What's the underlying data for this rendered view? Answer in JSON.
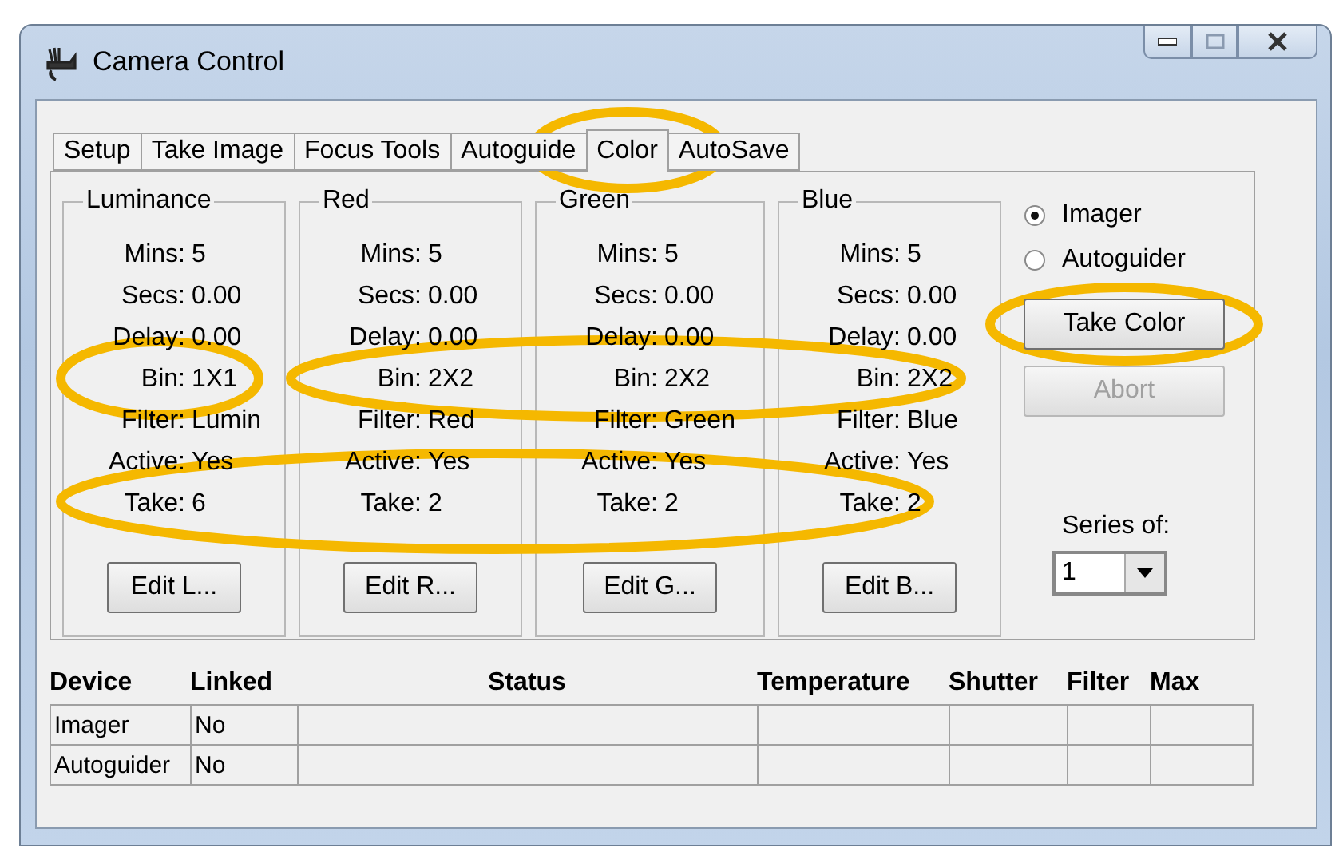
{
  "window": {
    "title": "Camera Control"
  },
  "tabs": [
    {
      "label": "Setup",
      "selected": false
    },
    {
      "label": "Take Image",
      "selected": false
    },
    {
      "label": "Focus Tools",
      "selected": false
    },
    {
      "label": "Autoguide",
      "selected": false
    },
    {
      "label": "Color",
      "selected": true
    },
    {
      "label": "AutoSave",
      "selected": false
    }
  ],
  "groups": [
    {
      "title": "Luminance",
      "fields": [
        {
          "label": "Mins:",
          "value": "5"
        },
        {
          "label": "Secs:",
          "value": "0.00"
        },
        {
          "label": "Delay:",
          "value": "0.00"
        },
        {
          "label": "Bin:",
          "value": "1X1"
        },
        {
          "label": "Filter:",
          "value": "Lumin"
        },
        {
          "label": "Active:",
          "value": "Yes"
        },
        {
          "label": "Take:",
          "value": "6"
        }
      ],
      "button": "Edit L..."
    },
    {
      "title": "Red",
      "fields": [
        {
          "label": "Mins:",
          "value": "5"
        },
        {
          "label": "Secs:",
          "value": "0.00"
        },
        {
          "label": "Delay:",
          "value": "0.00"
        },
        {
          "label": "Bin:",
          "value": "2X2"
        },
        {
          "label": "Filter:",
          "value": "Red"
        },
        {
          "label": "Active:",
          "value": "Yes"
        },
        {
          "label": "Take:",
          "value": "2"
        }
      ],
      "button": "Edit R..."
    },
    {
      "title": "Green",
      "fields": [
        {
          "label": "Mins:",
          "value": "5"
        },
        {
          "label": "Secs:",
          "value": "0.00"
        },
        {
          "label": "Delay:",
          "value": "0.00"
        },
        {
          "label": "Bin:",
          "value": "2X2"
        },
        {
          "label": "Filter:",
          "value": "Green"
        },
        {
          "label": "Active:",
          "value": "Yes"
        },
        {
          "label": "Take:",
          "value": "2"
        }
      ],
      "button": "Edit G..."
    },
    {
      "title": "Blue",
      "fields": [
        {
          "label": "Mins:",
          "value": "5"
        },
        {
          "label": "Secs:",
          "value": "0.00"
        },
        {
          "label": "Delay:",
          "value": "0.00"
        },
        {
          "label": "Bin:",
          "value": "2X2"
        },
        {
          "label": "Filter:",
          "value": "Blue"
        },
        {
          "label": "Active:",
          "value": "Yes"
        },
        {
          "label": "Take:",
          "value": "2"
        }
      ],
      "button": "Edit B..."
    }
  ],
  "source_options": [
    {
      "label": "Imager",
      "selected": true
    },
    {
      "label": "Autoguider",
      "selected": false
    }
  ],
  "take_button": {
    "label": "Take Color",
    "disabled": false
  },
  "abort_button": {
    "label": "Abort",
    "disabled": true
  },
  "series": {
    "label": "Series of:",
    "value": "1"
  },
  "table": {
    "columns": [
      "Device",
      "Linked",
      "Status",
      "Temperature",
      "Shutter",
      "Filter",
      "Max"
    ],
    "rows": [
      {
        "device": "Imager",
        "linked": "No"
      },
      {
        "device": "Autoguider",
        "linked": "No"
      }
    ]
  }
}
